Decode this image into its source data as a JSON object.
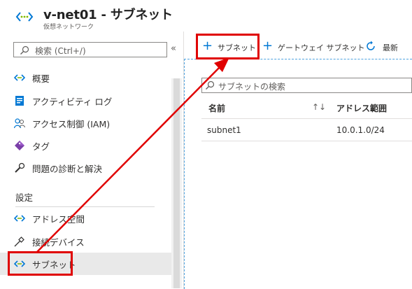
{
  "header": {
    "title": "v-net01 - サブネット",
    "subtitle": "仮想ネットワーク"
  },
  "sidebar": {
    "search_placeholder": "検索 (Ctrl+/)",
    "collapse_glyph": "«",
    "items": [
      {
        "label": "概要",
        "icon": "vnet-icon"
      },
      {
        "label": "アクティビティ ログ",
        "icon": "activity-log-icon"
      },
      {
        "label": "アクセス制御 (IAM)",
        "icon": "people-icon"
      },
      {
        "label": "タグ",
        "icon": "tag-icon"
      },
      {
        "label": "問題の診断と解決",
        "icon": "wrench-icon"
      }
    ],
    "section_label": "設定",
    "settings_items": [
      {
        "label": "アドレス空間",
        "icon": "vnet-icon"
      },
      {
        "label": "接続デバイス",
        "icon": "plug-icon"
      },
      {
        "label": "サブネット",
        "icon": "vnet-icon",
        "selected": true
      }
    ]
  },
  "toolbar": {
    "add_subnet": "サブネット",
    "gateway_subnet": "ゲートウェイ サブネット",
    "refresh": "最新"
  },
  "main": {
    "filter_placeholder": "サブネットの検索",
    "columns": [
      "名前",
      "アドレス範囲"
    ],
    "sort_glyph": "↑↓",
    "rows": [
      {
        "name": "subnet1",
        "address_range": "10.0.1.0/24"
      }
    ]
  },
  "colors": {
    "accent": "#0078d4",
    "annotation": "#e00000",
    "selected_bg": "#e9e9e9"
  }
}
